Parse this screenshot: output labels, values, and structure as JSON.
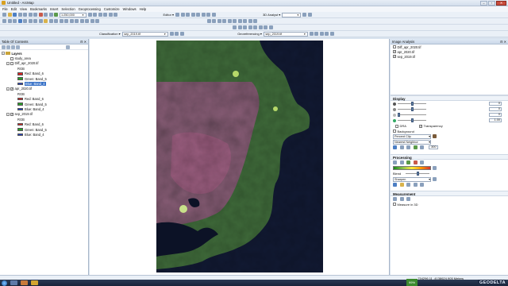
{
  "window": {
    "title": "Untitled - ArcMap"
  },
  "menu": [
    "File",
    "Edit",
    "View",
    "Bookmarks",
    "Insert",
    "Selection",
    "Geoprocessing",
    "Customize",
    "Windows",
    "Help"
  ],
  "toolbar": {
    "scale": "1:250,000",
    "editor_label": "Editor ▾",
    "analyst_label": "3D Analyst ▾",
    "classification_label": "Classification ▾",
    "classification_layer": "sep_2019.tif",
    "georeferencing_label": "Georeferencing ▾",
    "georef_layer": "sep_2019.tif"
  },
  "toc": {
    "title": "Table Of Contents",
    "root": "Layers",
    "layers": [
      {
        "name": "study_area",
        "checked": false
      },
      {
        "name": "Diff_apr_2020.tif",
        "checked": false,
        "legend": [
          {
            "label": "RGB",
            "color": ""
          },
          {
            "label": "Red: Band_6",
            "color": "#e02020"
          },
          {
            "label": "Green: Band_5",
            "color": "#28a028"
          },
          {
            "label": "Blue: Band_4",
            "color": "#2040d0",
            "selected": true
          }
        ]
      },
      {
        "name": "apr_2020.tif",
        "checked": true,
        "legend": [
          {
            "label": "RGB",
            "color": ""
          },
          {
            "label": "Red: Band_6",
            "color": "#e02020"
          },
          {
            "label": "Green: Band_5",
            "color": "#28a028"
          },
          {
            "label": "Blue: Band_4",
            "color": "#2040d0"
          }
        ]
      },
      {
        "name": "sep_2019.tif",
        "checked": true,
        "legend": [
          {
            "label": "RGB",
            "color": ""
          },
          {
            "label": "Red: Band_6",
            "color": "#e02020"
          },
          {
            "label": "Green: Band_5",
            "color": "#28a028"
          },
          {
            "label": "Blue: Band_4",
            "color": "#2040d0"
          }
        ]
      }
    ]
  },
  "image_analysis": {
    "title": "Image Analysis",
    "layers": [
      "Diff_apr_2020.tif",
      "apr_2020.tif",
      "sep_2019.tif"
    ],
    "display": {
      "title": "Display",
      "values": [
        "0",
        "0",
        "0",
        "1.00"
      ],
      "dra_label": "DRA",
      "background_label": "Background",
      "transparency_label": "Transparency",
      "stretch": "Percent Clip",
      "resampling": "Nearest Neighbor",
      "resolution": "300"
    },
    "processing": {
      "title": "Processing",
      "blend_label": "Blend",
      "sharpen": "Sharpen"
    },
    "measurement": {
      "title": "Measurement",
      "measure_3d_label": "Measure in 3D"
    }
  },
  "status": {
    "coords": "754296.11  -4138624.905 Meters"
  },
  "taskbar": {
    "zoom": "99%",
    "brand": "GEODELTA"
  }
}
